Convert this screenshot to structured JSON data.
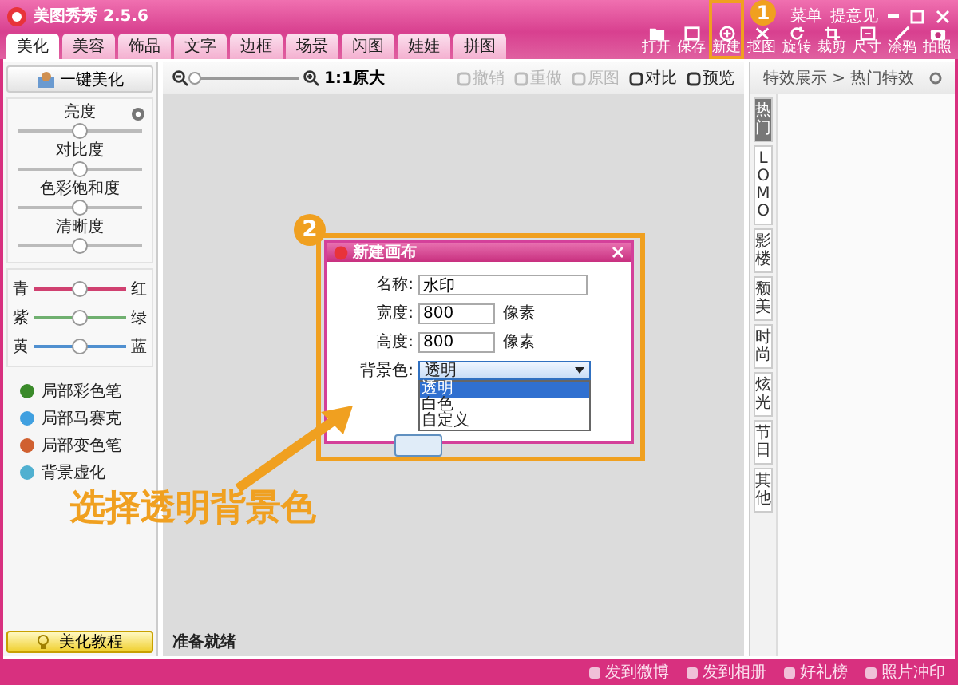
{
  "window": {
    "title": "美图秀秀 2.5.6",
    "links": [
      "菜单",
      "提意见"
    ]
  },
  "tabs": [
    {
      "label": "美化",
      "selected": true
    },
    {
      "label": "美容",
      "selected": false
    },
    {
      "label": "饰品",
      "selected": false
    },
    {
      "label": "文字",
      "selected": false
    },
    {
      "label": "边框",
      "selected": false
    },
    {
      "label": "场景",
      "selected": false
    },
    {
      "label": "闪图",
      "selected": false
    },
    {
      "label": "娃娃",
      "selected": false
    },
    {
      "label": "拼图",
      "selected": false
    }
  ],
  "toolbar": [
    {
      "label": "打开",
      "kind": "folder"
    },
    {
      "label": "保存",
      "kind": "save"
    },
    {
      "label": "新建",
      "kind": "new",
      "highlighted": true
    },
    {
      "label": "抠图",
      "kind": "cut"
    },
    {
      "label": "旋转",
      "kind": "rotate"
    },
    {
      "label": "裁剪",
      "kind": "crop"
    },
    {
      "label": "尺寸",
      "kind": "size"
    },
    {
      "label": "涂鸦",
      "kind": "brush"
    },
    {
      "label": "拍照",
      "kind": "camera"
    }
  ],
  "left_panel": {
    "one_click": "一键美化",
    "adjustments": [
      {
        "label": "亮度",
        "level": 0.5
      },
      {
        "label": "对比度",
        "level": 0.5
      },
      {
        "label": "色彩饱和度",
        "level": 0.5
      },
      {
        "label": "清晰度",
        "level": 0.5
      }
    ],
    "color_balance": [
      {
        "left": "青",
        "right": "红",
        "level": 0.5,
        "color": "#d04070"
      },
      {
        "left": "紫",
        "right": "绿",
        "level": 0.5,
        "color": "#70b070"
      },
      {
        "left": "黄",
        "right": "蓝",
        "level": 0.5,
        "color": "#5090d0"
      }
    ],
    "tools": [
      {
        "label": "局部彩色笔",
        "color": "#3a8a2a"
      },
      {
        "label": "局部马赛克",
        "color": "#40a0e0"
      },
      {
        "label": "局部变色笔",
        "color": "#d06030"
      },
      {
        "label": "背景虚化",
        "color": "#50b0d0"
      }
    ],
    "tutorial": "美化教程"
  },
  "canvas": {
    "zoom": {
      "level": 0.02,
      "label": "1:1原大"
    },
    "actions": [
      {
        "label": "撤销",
        "disabled": true
      },
      {
        "label": "重做",
        "disabled": true
      },
      {
        "label": "原图",
        "disabled": true
      },
      {
        "label": "对比",
        "disabled": false
      },
      {
        "label": "预览",
        "disabled": false
      }
    ],
    "status": "准备就绪"
  },
  "dialog": {
    "title": "新建画布",
    "name_label": "名称:",
    "name_value": "水印",
    "size_fields": [
      {
        "label": "宽度:",
        "value": "800",
        "unit": "像素"
      },
      {
        "label": "高度:",
        "value": "800",
        "unit": "像素"
      }
    ],
    "background_label": "背景色:",
    "background_value": "透明",
    "options": [
      {
        "label": "透明",
        "selected": true
      },
      {
        "label": "白色",
        "selected": false
      },
      {
        "label": "自定义",
        "selected": false
      }
    ]
  },
  "right_panel": {
    "breadcrumb": "特效展示 > 热门特效",
    "side_tabs": [
      {
        "label": "热门",
        "selected": true
      },
      {
        "label": "LOMO",
        "selected": false
      },
      {
        "label": "影楼",
        "selected": false
      },
      {
        "label": "颓美",
        "selected": false
      },
      {
        "label": "时尚",
        "selected": false
      },
      {
        "label": "炫光",
        "selected": false
      },
      {
        "label": "节日",
        "selected": false
      },
      {
        "label": "其他",
        "selected": false
      }
    ]
  },
  "bottom_bar": [
    "发到微博",
    "发到相册",
    "好礼榜",
    "照片冲印"
  ],
  "annotations": {
    "callouts": [
      "1",
      "2"
    ],
    "caption": "选择透明背景色"
  }
}
